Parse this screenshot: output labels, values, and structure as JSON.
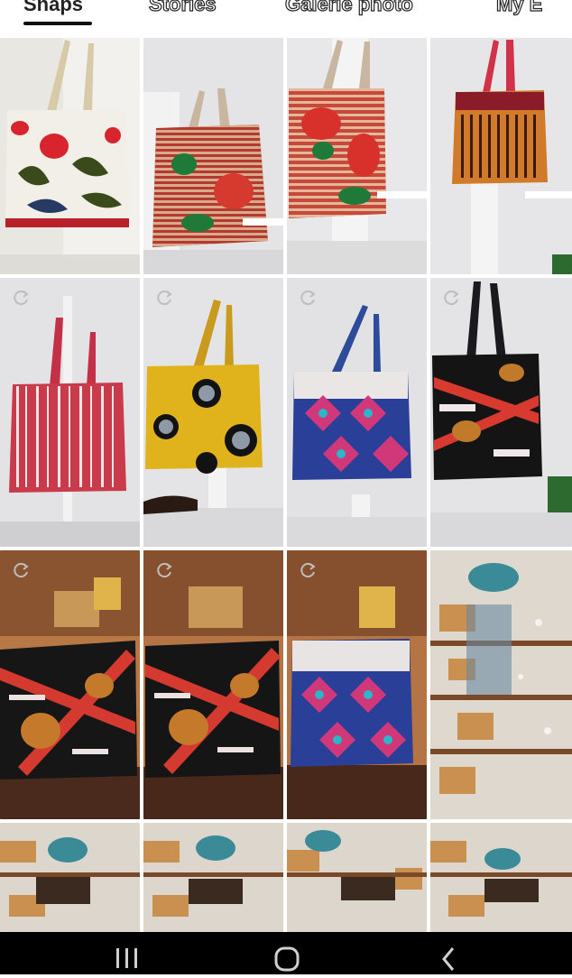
{
  "tabs": [
    {
      "label": "Snaps",
      "active": true
    },
    {
      "label": "Stories",
      "active": false
    },
    {
      "label": "Galerie photo",
      "active": false
    },
    {
      "label": "My E",
      "active": false
    }
  ],
  "grid": {
    "rows": [
      [
        "bag-floral-white",
        "bag-red-rose",
        "bag-red-rose-2",
        "bag-orange-stripes"
      ],
      [
        "bag-red-stripes",
        "bag-yellow-circles",
        "bag-blue-diamond",
        "bag-red-geometric"
      ],
      [
        "bags-on-table-1",
        "bags-on-table-2",
        "bag-blue-on-table",
        "shop-shelf-blur"
      ],
      [
        "shop-shelf-1",
        "shop-shelf-2",
        "shop-shelf-3",
        "shop-shelf-4"
      ]
    ],
    "sync_icon_rows": [
      1,
      2
    ]
  },
  "navbar": {
    "recent_apps": "recent-apps-icon",
    "home": "home-icon",
    "back": "back-icon"
  },
  "colors": {
    "accent": "#e0245e",
    "tab_text": "#222222",
    "navbar_bg": "#000000"
  }
}
